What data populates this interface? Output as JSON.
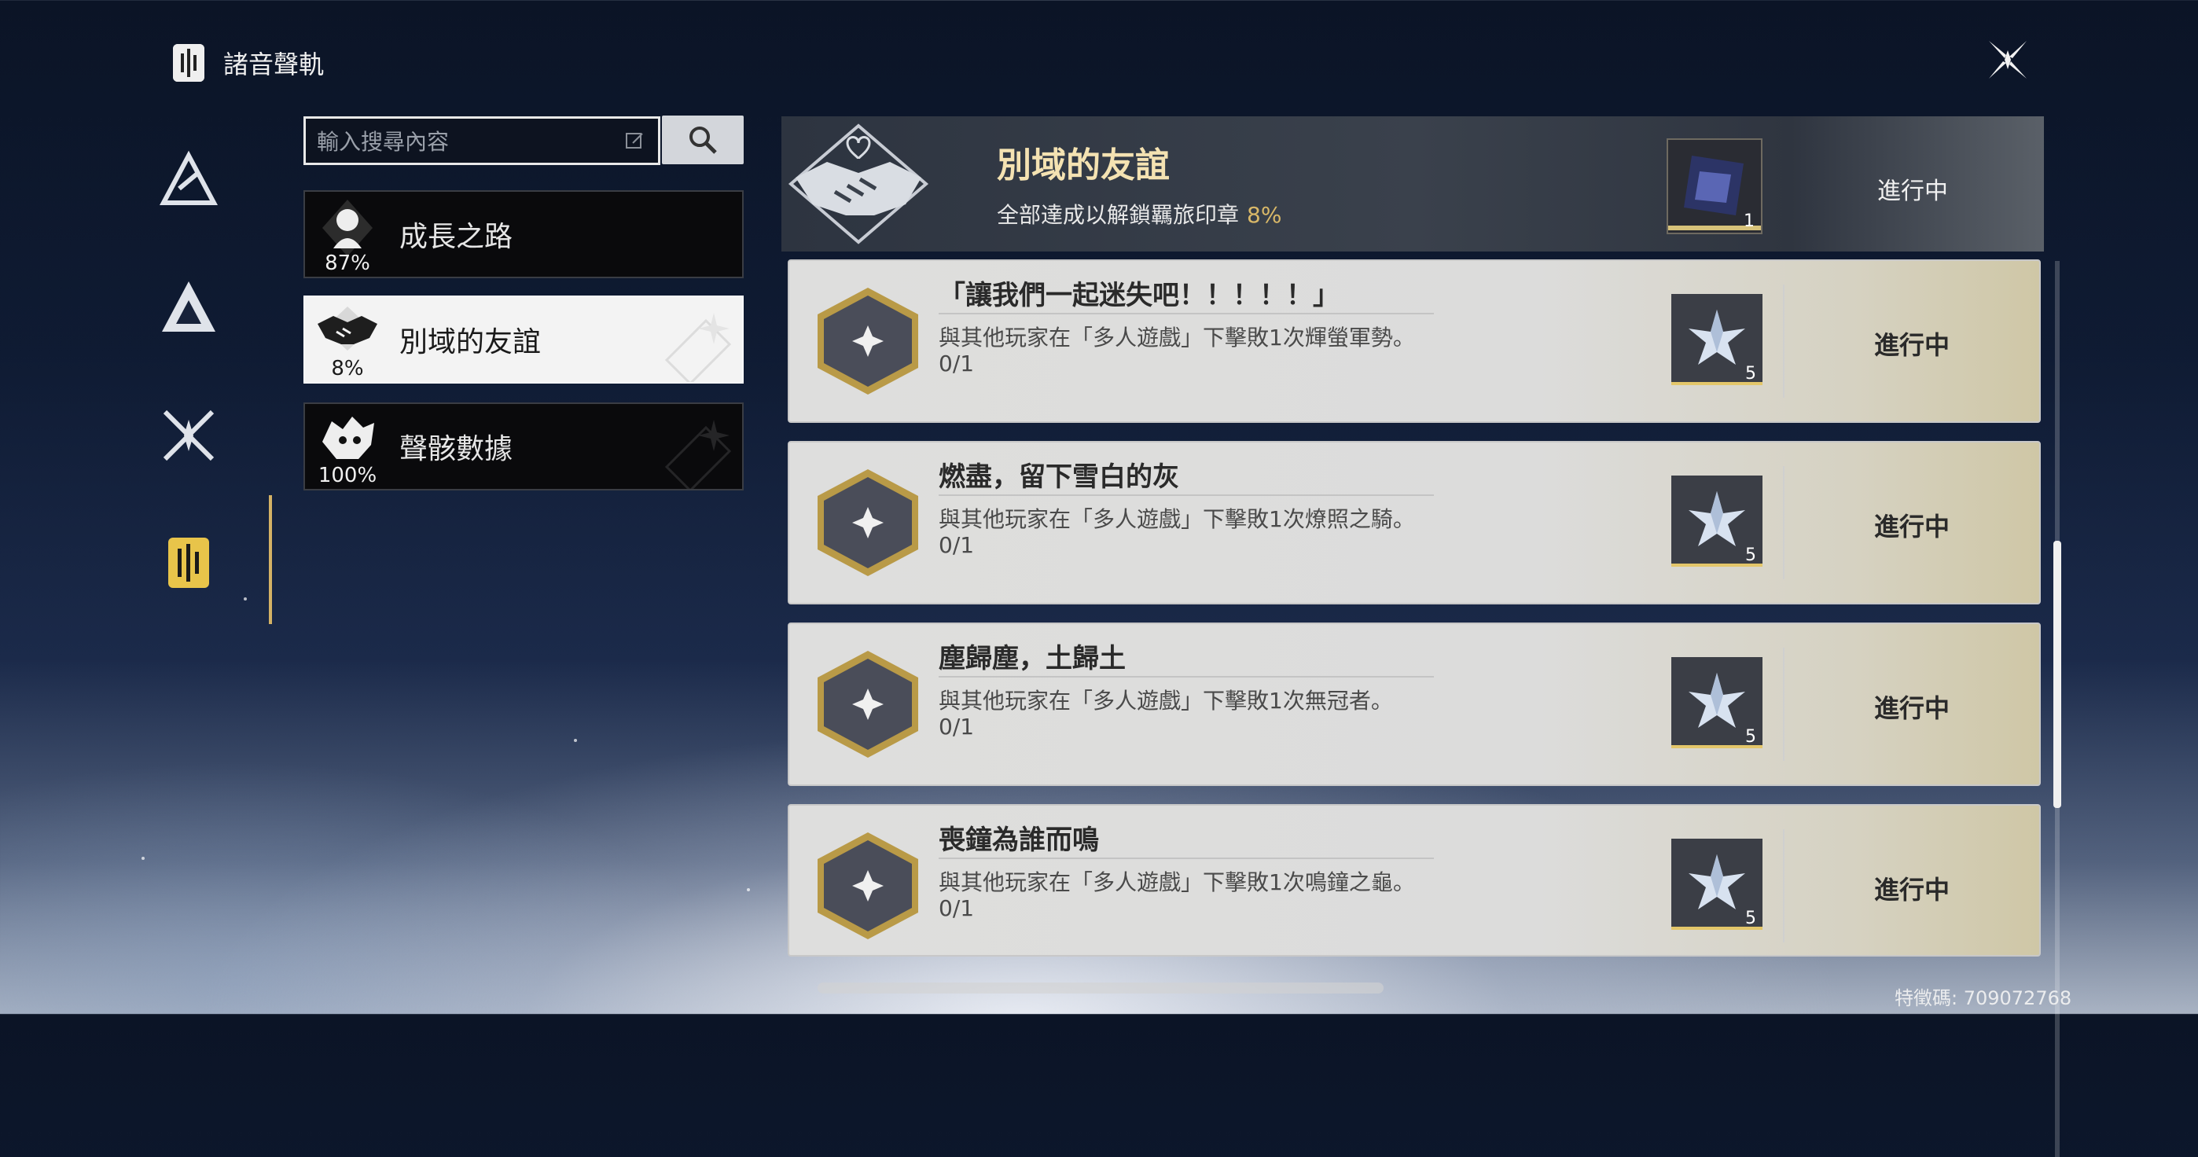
{
  "header": {
    "title": "諸音聲軌"
  },
  "search": {
    "placeholder": "輸入搜尋內容"
  },
  "categories": [
    {
      "name": "成長之路",
      "percent": "87%"
    },
    {
      "name": "別域的友誼",
      "percent": "8%"
    },
    {
      "name": "聲骸數據",
      "percent": "100%"
    }
  ],
  "banner": {
    "title": "別域的友誼",
    "subtitle": "全部達成以解鎖羈旅印章",
    "percent": "8%",
    "reward_qty": "1",
    "status": "進行中"
  },
  "achievements": [
    {
      "title": "「讓我們一起迷失吧！！！！！」",
      "desc": "與其他玩家在「多人遊戲」下擊敗1次輝螢軍勢。",
      "progress": "0/1",
      "reward_qty": "5",
      "status": "進行中"
    },
    {
      "title": "燃盡，留下雪白的灰",
      "desc": "與其他玩家在「多人遊戲」下擊敗1次燎照之騎。",
      "progress": "0/1",
      "reward_qty": "5",
      "status": "進行中"
    },
    {
      "title": "塵歸塵，土歸土",
      "desc": "與其他玩家在「多人遊戲」下擊敗1次無冠者。",
      "progress": "0/1",
      "reward_qty": "5",
      "status": "進行中"
    },
    {
      "title": "喪鐘為誰而鳴",
      "desc": "與其他玩家在「多人遊戲」下擊敗1次鳴鐘之龜。",
      "progress": "0/1",
      "reward_qty": "5",
      "status": "進行中"
    }
  ],
  "footer": {
    "uid": "特徵碼: 709072768"
  },
  "colors": {
    "accent_gold": "#d4b265",
    "active_bg": "#f3f3f3",
    "card_bg": "#dededd"
  }
}
